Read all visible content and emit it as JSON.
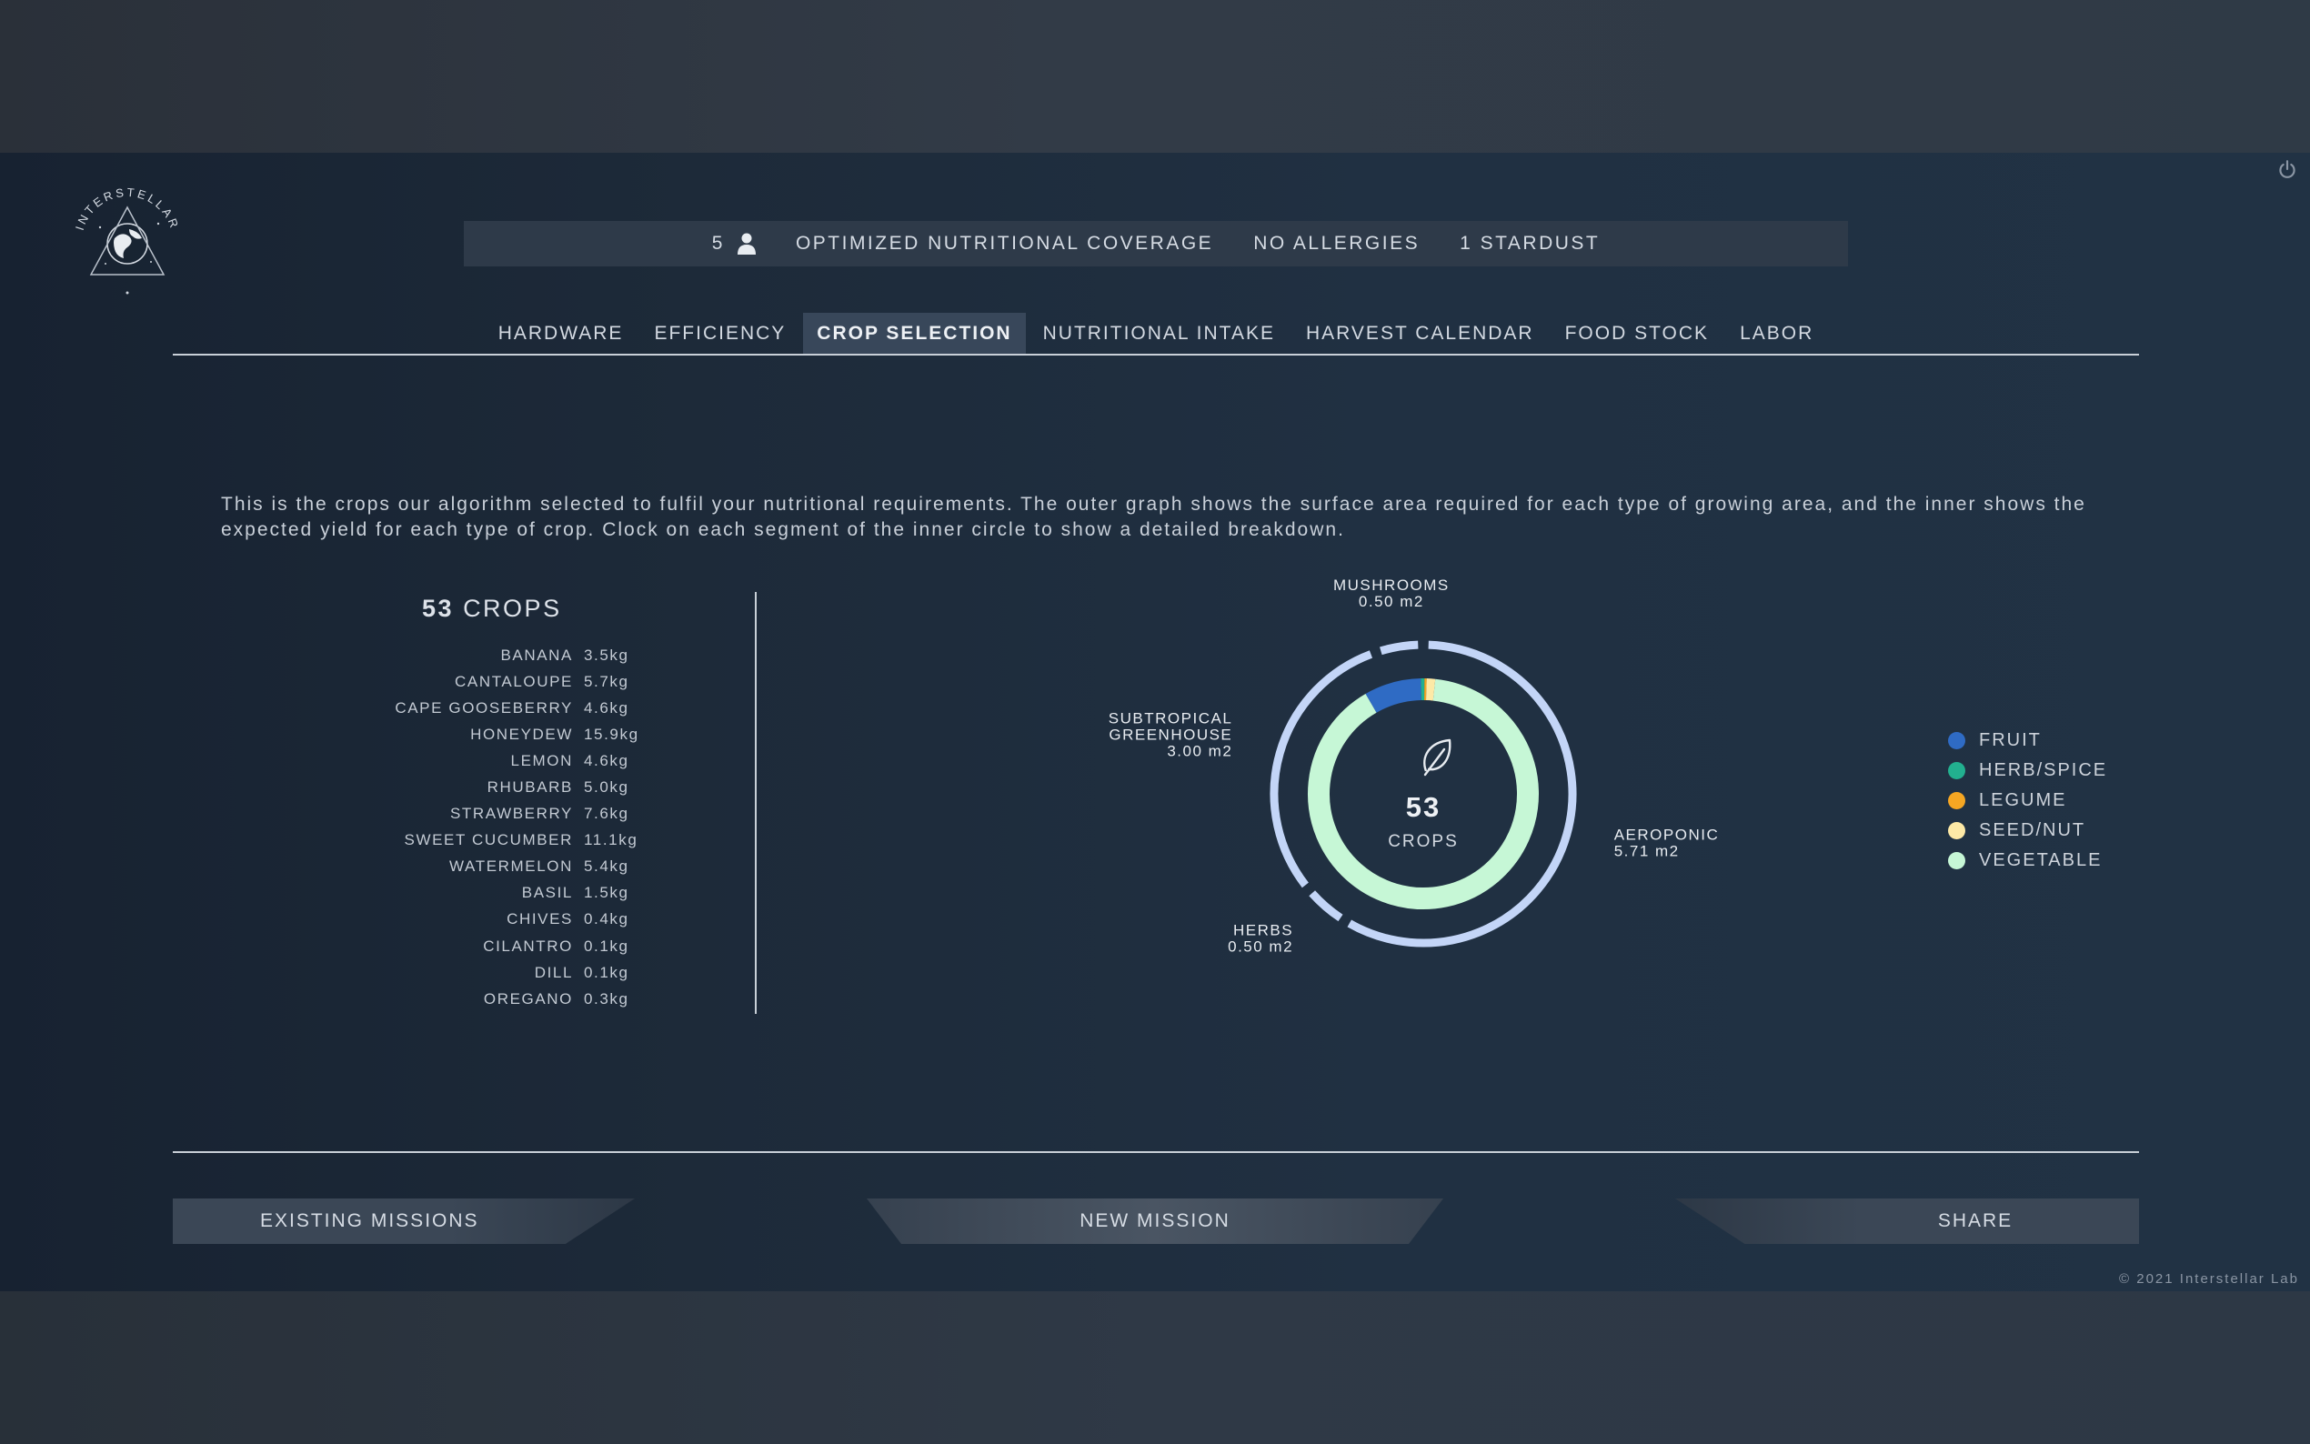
{
  "brand": {
    "logo_text": "INTERSTELLAR"
  },
  "summary": {
    "people_count": "5",
    "coverage": "OPTIMIZED NUTRITIONAL COVERAGE",
    "allergies": "NO ALLERGIES",
    "stardust": "1 STARDUST"
  },
  "tabs": [
    {
      "label": "HARDWARE"
    },
    {
      "label": "EFFICIENCY"
    },
    {
      "label": "CROP SELECTION",
      "active": true
    },
    {
      "label": "NUTRITIONAL INTAKE"
    },
    {
      "label": "HARVEST CALENDAR"
    },
    {
      "label": "FOOD STOCK"
    },
    {
      "label": "LABOR"
    }
  ],
  "description": "This is the crops our algorithm selected to fulfil your nutritional requirements. The outer graph shows the surface area required for each type of growing area, and the inner shows the expected yield for each type of crop. Clock on each segment of the inner circle to show a detailed breakdown.",
  "crops": {
    "count": "53",
    "label": "CROPS",
    "items": [
      {
        "name": "BANANA",
        "value": "3.5kg"
      },
      {
        "name": "CANTALOUPE",
        "value": "5.7kg"
      },
      {
        "name": "CAPE GOOSEBERRY",
        "value": "4.6kg"
      },
      {
        "name": "HONEYDEW",
        "value": "15.9kg"
      },
      {
        "name": "LEMON",
        "value": "4.6kg"
      },
      {
        "name": "RHUBARB",
        "value": "5.0kg"
      },
      {
        "name": "STRAWBERRY",
        "value": "7.6kg"
      },
      {
        "name": "SWEET CUCUMBER",
        "value": "11.1kg"
      },
      {
        "name": "WATERMELON",
        "value": "5.4kg"
      },
      {
        "name": "BASIL",
        "value": "1.5kg"
      },
      {
        "name": "CHIVES",
        "value": "0.4kg"
      },
      {
        "name": "CILANTRO",
        "value": "0.1kg"
      },
      {
        "name": "DILL",
        "value": "0.1kg"
      },
      {
        "name": "OREGANO",
        "value": "0.3kg"
      }
    ]
  },
  "chart_data": {
    "type": "pie",
    "center": {
      "value": "53",
      "label": "CROPS",
      "icon": "leaf-icon"
    },
    "outer_ring": [
      {
        "name": "AEROPONIC",
        "value": 5.71,
        "label": "5.71 m2"
      },
      {
        "name": "HERBS",
        "value": 0.5,
        "label": "0.50 m2"
      },
      {
        "name": "SUBTROPICAL GREENHOUSE",
        "value": 3.0,
        "label": "3.00 m2"
      },
      {
        "name": "MUSHROOMS",
        "value": 0.5,
        "label": "0.50 m2"
      }
    ],
    "inner_ring": [
      {
        "name": "FRUIT",
        "value": 8.0,
        "color": "#2f6bc4"
      },
      {
        "name": "HERB/SPICE",
        "value": 0.5,
        "color": "#22b08f"
      },
      {
        "name": "LEGUME",
        "value": 0.3,
        "color": "#f5a623"
      },
      {
        "name": "SEED/NUT",
        "value": 1.2,
        "color": "#fde9a6"
      },
      {
        "name": "VEGETABLE",
        "value": 90.0,
        "color": "#c6f7d6"
      }
    ],
    "outer_color": "#c3d5f7",
    "legend_position": "right"
  },
  "legend": [
    {
      "label": "FRUIT",
      "color": "#2f6bc4"
    },
    {
      "label": "HERB/SPICE",
      "color": "#22b08f"
    },
    {
      "label": "LEGUME",
      "color": "#f5a623"
    },
    {
      "label": "SEED/NUT",
      "color": "#fde9a6"
    },
    {
      "label": "VEGETABLE",
      "color": "#c6f7d6"
    }
  ],
  "footer": {
    "existing_missions": "EXISTING MISSIONS",
    "new_mission": "NEW MISSION",
    "share": "SHARE",
    "copyright": "© 2021 Interstellar Lab"
  }
}
